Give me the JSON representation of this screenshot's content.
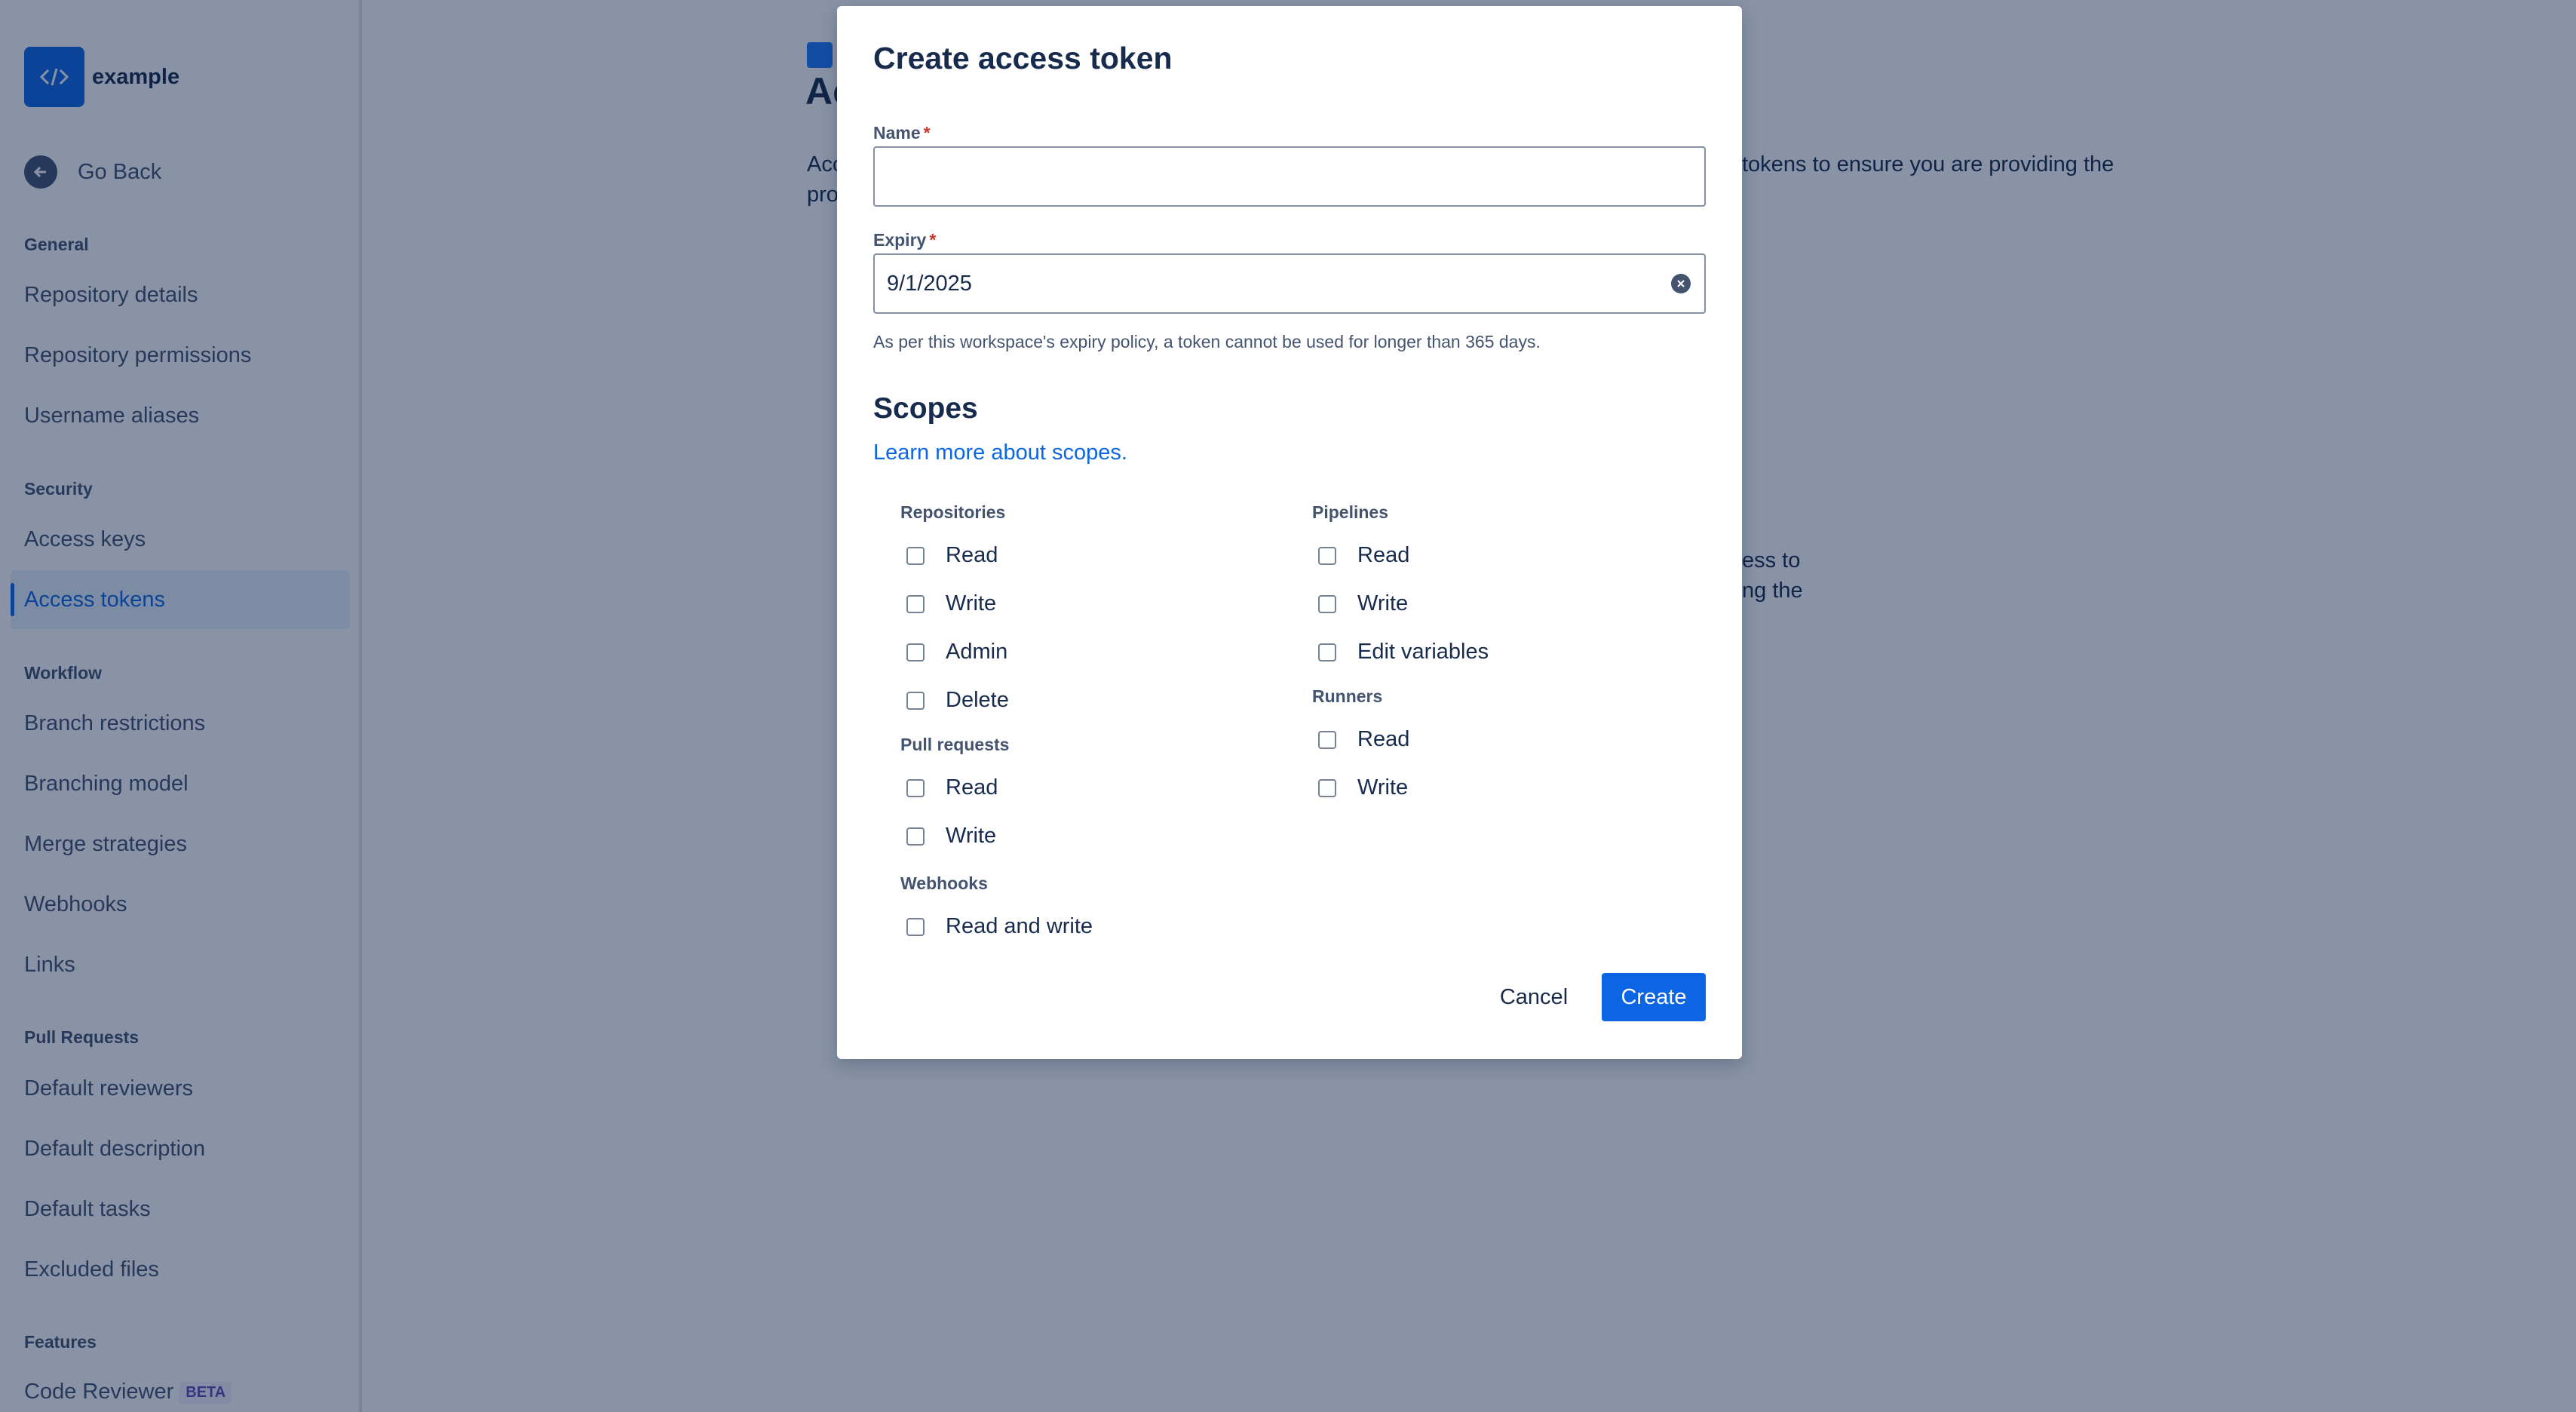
{
  "sidebar": {
    "repo_name": "example",
    "go_back": "Go Back",
    "sections": {
      "general": {
        "title": "General",
        "items": [
          "Repository details",
          "Repository permissions",
          "Username aliases"
        ]
      },
      "security": {
        "title": "Security",
        "items": [
          "Access keys",
          "Access tokens"
        ]
      },
      "workflow": {
        "title": "Workflow",
        "items": [
          "Branch restrictions",
          "Branching model",
          "Merge strategies",
          "Webhooks",
          "Links"
        ]
      },
      "pull_requests": {
        "title": "Pull Requests",
        "items": [
          "Default reviewers",
          "Default description",
          "Default tasks",
          "Excluded files"
        ]
      },
      "features": {
        "title": "Features",
        "items": [
          "Code Reviewer"
        ],
        "badge": "BETA"
      }
    },
    "active_item": "Access tokens"
  },
  "background": {
    "title_fragment": "Ac",
    "line1_start": "Acc",
    "line1_end": "tokens to ensure you are providing the",
    "line2_start": "pro",
    "line3_end": "ess to",
    "line4_end": "ng the"
  },
  "modal": {
    "title": "Create access token",
    "name_label": "Name",
    "name_value": "",
    "expiry_label": "Expiry",
    "expiry_value": "9/1/2025",
    "required_mark": "*",
    "helper": "As per this workspace's expiry policy, a token cannot be used for longer than 365 days.",
    "scopes_title": "Scopes",
    "learn_more": "Learn more about scopes.",
    "groups": {
      "repositories": {
        "label": "Repositories",
        "options": [
          "Read",
          "Write",
          "Admin",
          "Delete"
        ]
      },
      "pull_requests": {
        "label": "Pull requests",
        "options": [
          "Read",
          "Write"
        ]
      },
      "webhooks": {
        "label": "Webhooks",
        "options": [
          "Read and write"
        ]
      },
      "pipelines": {
        "label": "Pipelines",
        "options": [
          "Read",
          "Write",
          "Edit variables"
        ]
      },
      "runners": {
        "label": "Runners",
        "options": [
          "Read",
          "Write"
        ]
      }
    },
    "cancel": "Cancel",
    "create": "Create"
  },
  "colors": {
    "accent": "#0c66e4",
    "overlay": "#091e42",
    "required": "#c9372c"
  },
  "icons": {
    "repo": "code-icon",
    "go_back": "arrow-left-icon",
    "clear": "clear-icon",
    "page": "document-icon"
  }
}
